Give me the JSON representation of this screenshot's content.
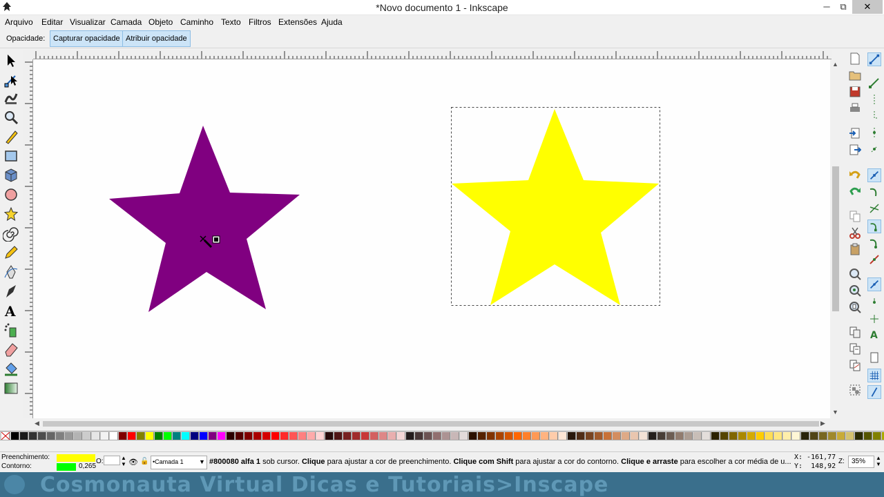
{
  "window": {
    "title": "*Novo documento 1 - Inkscape",
    "minimize": "─",
    "restore": "⧉",
    "close": "✕"
  },
  "menu": [
    "Arquivo",
    "Editar",
    "Visualizar",
    "Camada",
    "Objeto",
    "Caminho",
    "Texto",
    "Filtros",
    "Extensões",
    "Ajuda"
  ],
  "tool_controls": {
    "label": "Opacidade:",
    "capture": "Capturar opacidade",
    "assign": "Atribuir opacidade"
  },
  "canvas": {
    "star_purple_color": "#800080",
    "star_yellow_color": "#ffff00"
  },
  "status": {
    "fill_label": "Preenchimento:",
    "stroke_label": "Contorno:",
    "fill_color": "#ffff00",
    "stroke_color": "#00ff00",
    "stroke_width": "0,265",
    "opacity_label": "O:",
    "layer": "•Camada 1",
    "message_color": "#800080 alfa 1",
    "message_part1": " sob cursor. ",
    "message_b1": "Clique",
    "message_part2": " para ajustar a cor de preenchimento. ",
    "message_b2": "Clique com Shift",
    "message_part3": " para ajustar a cor do contorno. ",
    "message_b3": "Clique e arraste",
    "message_part4": " para escolher a cor média de u...",
    "coord_x": "X: -161,77",
    "coord_y": "Y:  148,92",
    "zoom_label": "Z:",
    "zoom": "35%"
  },
  "watermark": {
    "text": "Cosmonauta Virtual Dicas e Tutoriais>Inscape"
  },
  "palette": [
    "#000000",
    "#1a1a1a",
    "#333333",
    "#4d4d4d",
    "#666666",
    "#808080",
    "#999999",
    "#b3b3b3",
    "#cccccc",
    "#e6e6e6",
    "#f2f2f2",
    "#ffffff",
    "#800000",
    "#ff0000",
    "#808000",
    "#ffff00",
    "#008000",
    "#00ff00",
    "#008080",
    "#00ffff",
    "#000080",
    "#0000ff",
    "#800080",
    "#ff00ff",
    "#2b0000",
    "#550000",
    "#800000",
    "#aa0000",
    "#d40000",
    "#ff0000",
    "#ff2a2a",
    "#ff5555",
    "#ff8080",
    "#ffaaaa",
    "#ffd5d5",
    "#280b0b",
    "#501616",
    "#782121",
    "#a02c2c",
    "#c83737",
    "#d35f5f",
    "#de8787",
    "#e9afaf",
    "#f4d7d7",
    "#241c1c",
    "#483737",
    "#6c5353",
    "#916f6f",
    "#ac9393",
    "#c8b7b7",
    "#e3dbdb",
    "#2b1100",
    "#552200",
    "#803300",
    "#aa4400",
    "#d45500",
    "#ff6600",
    "#ff7f2a",
    "#ff9955",
    "#ffb380",
    "#ffccaa",
    "#ffe6d5",
    "#28170b",
    "#502d16",
    "#784421",
    "#a05a2c",
    "#c87137",
    "#d38d5f",
    "#deaa87",
    "#e9c6af",
    "#f4e3d7",
    "#241f1c",
    "#483e37",
    "#6c5d53",
    "#917c6f",
    "#ac9d93",
    "#c8beb7",
    "#e3dedb",
    "#2b2200",
    "#554400",
    "#806600",
    "#aa8800",
    "#d4aa00",
    "#ffcc00",
    "#ffdd55",
    "#ffe680",
    "#ffeeaa",
    "#fff6d5",
    "#28220b",
    "#504416",
    "#786721",
    "#a0892c",
    "#c8ab37",
    "#d4c26f",
    "#2b2b00",
    "#555500",
    "#808000",
    "#aaaa00",
    "#d4d400"
  ]
}
